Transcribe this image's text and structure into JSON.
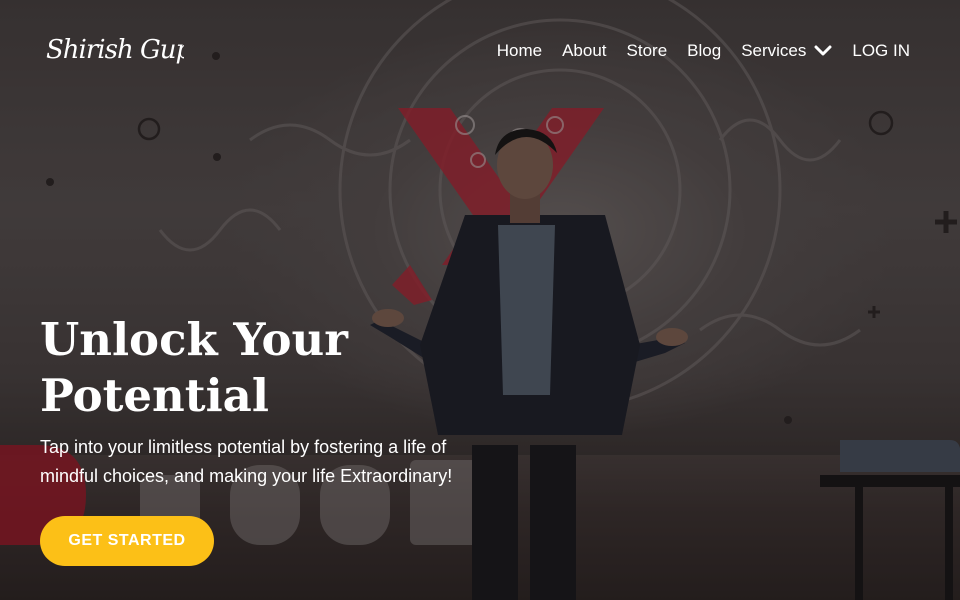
{
  "brand": {
    "logo_text": "Shirish Gupta"
  },
  "nav": {
    "items": [
      {
        "label": "Home"
      },
      {
        "label": "About"
      },
      {
        "label": "Store"
      },
      {
        "label": "Blog"
      },
      {
        "label": "Services",
        "icon": "chevron-down-icon"
      },
      {
        "label": "LOG IN"
      }
    ]
  },
  "hero": {
    "title_line1": "Unlock Your",
    "title_line2": "Potential",
    "subtitle_line1": "Tap into your limitless potential by fostering a life of",
    "subtitle_line2": "mindful choices, and making your life Extraordinary!",
    "cta_label": "GET STARTED",
    "background_image": "speaker-on-stage-photo"
  },
  "colors": {
    "cta_background": "#fcc017",
    "cta_text": "#ffffff",
    "text": "#ffffff",
    "backdrop_accent": "#c0283a"
  }
}
